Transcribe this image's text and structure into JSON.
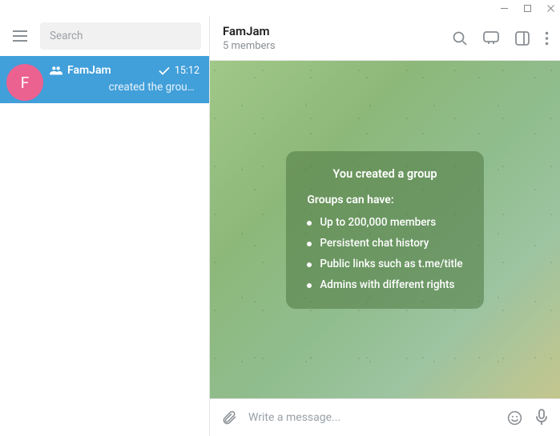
{
  "window_controls": {
    "minimize": "minimize",
    "maximize": "maximize",
    "close": "close"
  },
  "sidebar": {
    "search_placeholder": "Search",
    "chat": {
      "avatar_letter": "F",
      "name": "FamJam",
      "time": "15:12",
      "preview": "created the grou…"
    }
  },
  "header": {
    "title": "FamJam",
    "subtitle": "5 members"
  },
  "service_card": {
    "title": "You created a group",
    "subtitle": "Groups can have:",
    "items": [
      "Up to 200,000 members",
      "Persistent chat history",
      "Public links such as t.me/title",
      "Admins with different rights"
    ]
  },
  "composer": {
    "placeholder": "Write a message..."
  }
}
